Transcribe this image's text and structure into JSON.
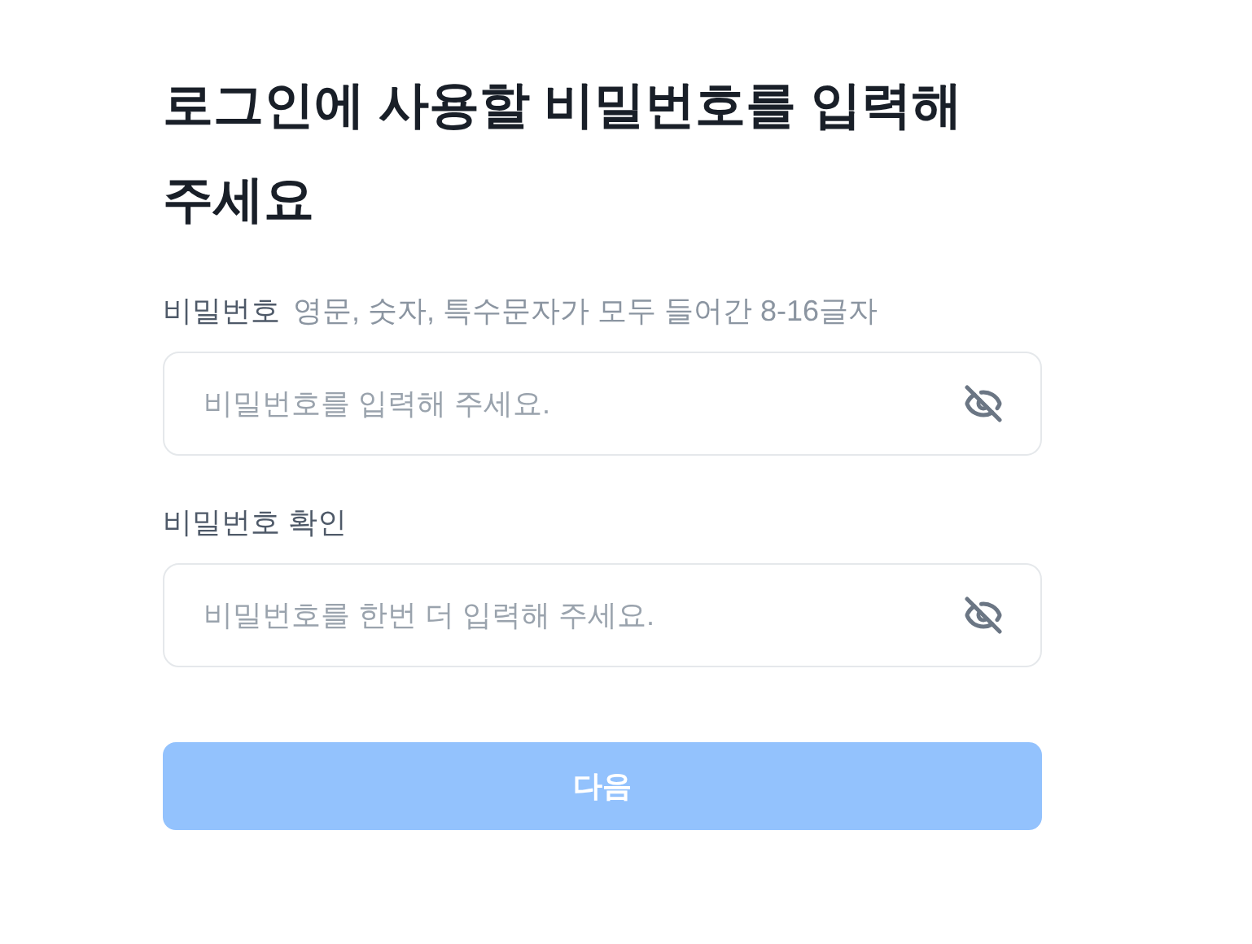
{
  "title": "로그인에 사용할 비밀번호를 입력해 주세요",
  "fields": [
    {
      "label": "비밀번호",
      "hint": "영문, 숫자, 특수문자가 모두 들어간 8-16글자",
      "placeholder": "비밀번호를 입력해 주세요.",
      "password_visible": false
    },
    {
      "label": "비밀번호 확인",
      "placeholder": "비밀번호를 한번 더 입력해 주세요.",
      "password_visible": false
    }
  ],
  "next_button": {
    "label": "다음",
    "disabled": true
  }
}
